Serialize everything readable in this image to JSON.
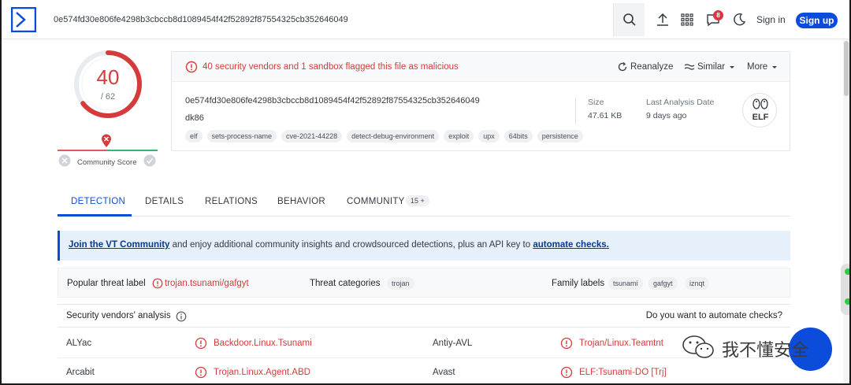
{
  "topbar": {
    "search_value": "0e574fd30e806fe4298b3cbccb8d1089454f42f52892f87554325cb352646049",
    "notification_count": "8",
    "sign_in": "Sign in",
    "sign_up": "Sign up",
    "accent": "#0b4dda"
  },
  "score": {
    "positives": "40",
    "total": "/ 62",
    "community_label": "Community Score"
  },
  "summary": {
    "alert": "40 security vendors and 1 sandbox flagged this file as malicious",
    "actions": {
      "reanalyze": "Reanalyze",
      "similar": "Similar",
      "more": "More"
    },
    "hash": "0e574fd30e806fe4298b3cbccb8d1089454f42f52892f87554325cb352646049",
    "filename": "dk86",
    "size_label": "Size",
    "size_value": "47.61 KB",
    "last_analysis_label": "Last Analysis Date",
    "last_analysis_value": "9 days ago",
    "file_type": "ELF",
    "tags": [
      "elf",
      "sets-process-name",
      "cve-2021-44228",
      "detect-debug-environment",
      "exploit",
      "upx",
      "64bits",
      "persistence"
    ],
    "malicious_color": "#d63b3b"
  },
  "tabs": {
    "detection": "DETECTION",
    "details": "DETAILS",
    "relations": "RELATIONS",
    "behavior": "BEHAVIOR",
    "community": "COMMUNITY",
    "community_count": "15 +"
  },
  "banner": {
    "link1": "Join the VT Community",
    "middle": " and enjoy additional community insights and crowdsourced detections, plus an API key to ",
    "link2": "automate checks."
  },
  "labels": {
    "popular_label": "Popular threat label",
    "popular_value": "trojan.tsunami/gafgyt",
    "categories_label": "Threat categories",
    "categories": [
      "trojan"
    ],
    "family_label": "Family labels",
    "families": [
      "tsunami",
      "gafgyt",
      "iznqt"
    ]
  },
  "vendors": {
    "title": "Security vendors' analysis",
    "automate_question": "Do you want to automate checks?",
    "rows": [
      {
        "left_name": "ALYac",
        "left_result": "Backdoor.Linux.Tsunami",
        "right_name": "Antiy-AVL",
        "right_result": "Trojan/Linux.Teamtnt"
      },
      {
        "left_name": "Arcabit",
        "left_result": "Trojan.Linux.Agent.ABD",
        "right_name": "Avast",
        "right_result": "ELF:Tsunami-DO [Trj]"
      }
    ]
  },
  "watermark": {
    "text": "我不懂安全"
  }
}
